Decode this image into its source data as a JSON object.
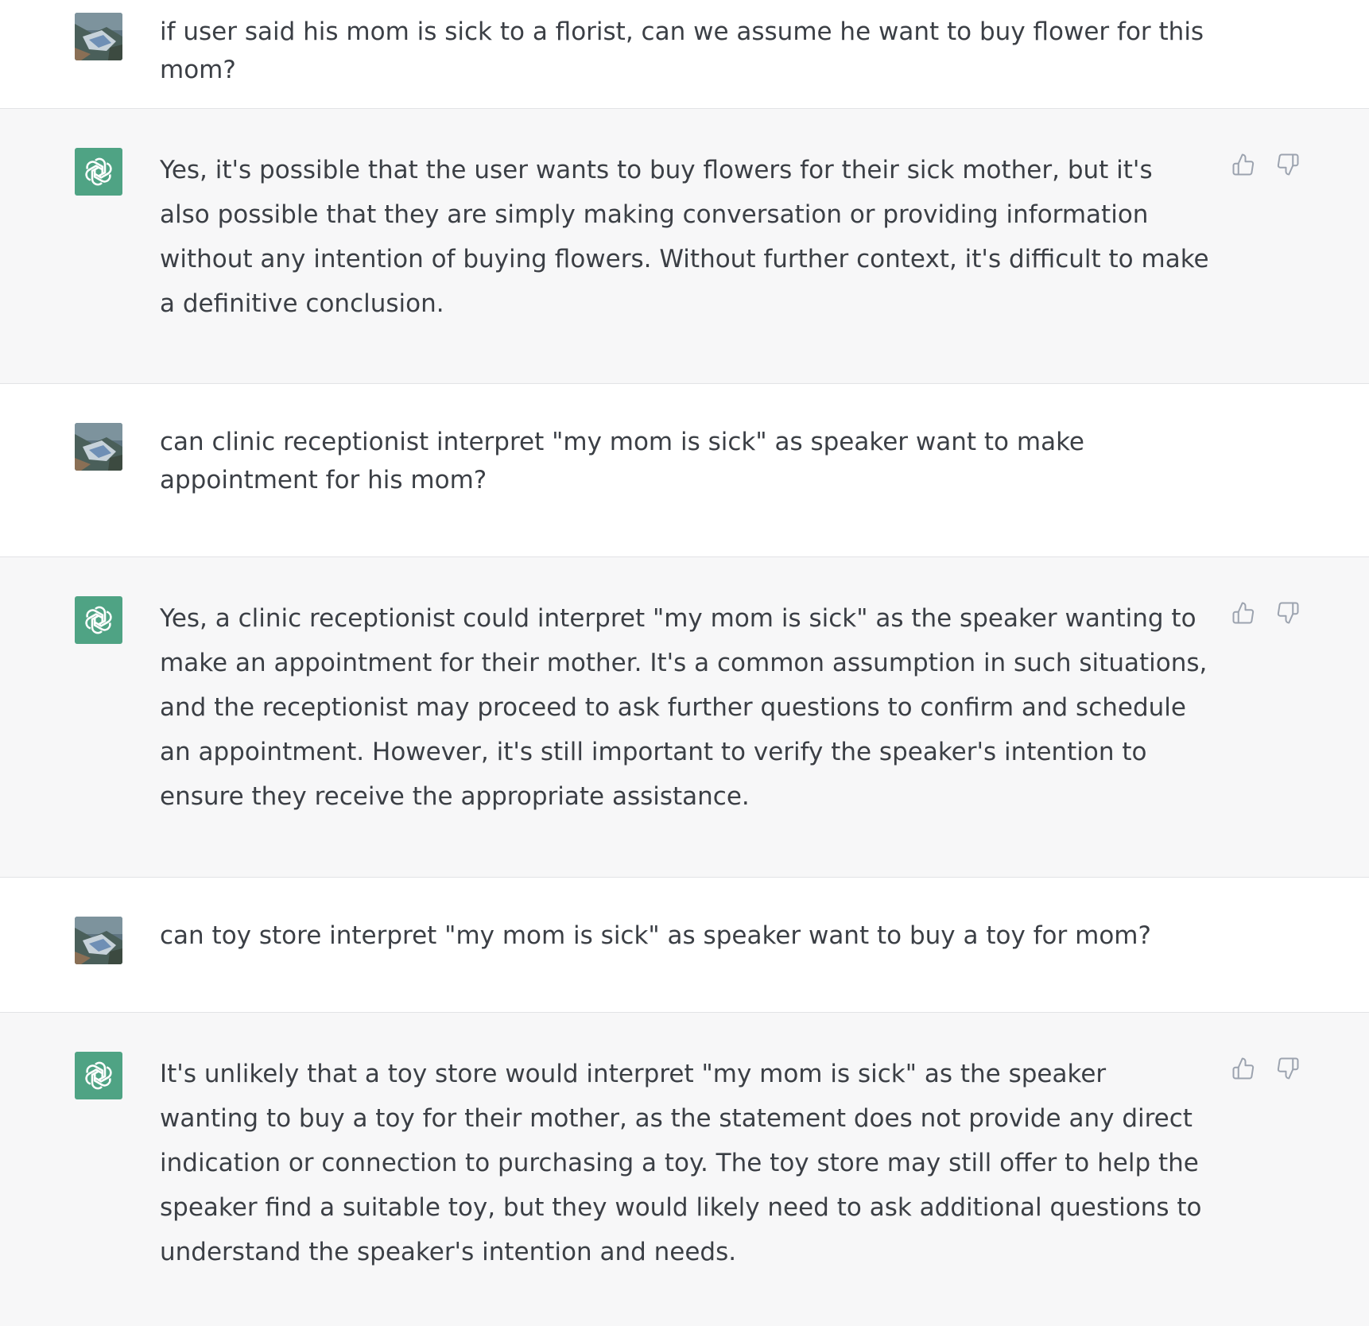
{
  "conversation": {
    "messages": [
      {
        "role": "user",
        "text": "if user said his mom is sick to a florist, can we assume he want to buy flower for this mom?"
      },
      {
        "role": "assistant",
        "text": "Yes, it's possible that the user wants to buy flowers for their sick mother, but it's also possible that they are simply making conversation or providing information without any intention of buying flowers. Without further context, it's difficult to make a definitive conclusion."
      },
      {
        "role": "user",
        "text": "can clinic receptionist interpret \"my mom is sick\"  as speaker want to make appointment for his mom?"
      },
      {
        "role": "assistant",
        "text": "Yes, a clinic receptionist could interpret \"my mom is sick\" as the speaker wanting to make an appointment for their mother. It's a common assumption in such situations, and the receptionist may proceed to ask further questions to confirm and schedule an appointment. However, it's still important to verify the speaker's intention to ensure they receive the appropriate assistance."
      },
      {
        "role": "user",
        "text": "can toy store interpret \"my mom is sick\" as speaker want to buy a toy for mom?"
      },
      {
        "role": "assistant",
        "text": "It's unlikely that a toy store would interpret \"my mom is sick\" as the speaker wanting to buy a toy for their mother, as the statement does not provide any direct indication or connection to purchasing a toy. The toy store may still offer to help the speaker find a suitable toy, but they would likely need to ask additional questions to understand the speaker's intention and needs."
      }
    ]
  },
  "icons": {
    "user_avatar": "user-avatar-photo",
    "assistant_avatar": "openai-logo-icon",
    "thumbs_up": "thumbs-up-icon",
    "thumbs_down": "thumbs-down-icon"
  },
  "colors": {
    "user_bg": "#ffffff",
    "assistant_bg": "#f7f7f8",
    "assistant_avatar_bg": "#4fa384",
    "text": "#3b3f45",
    "icon": "#9ca3af"
  }
}
